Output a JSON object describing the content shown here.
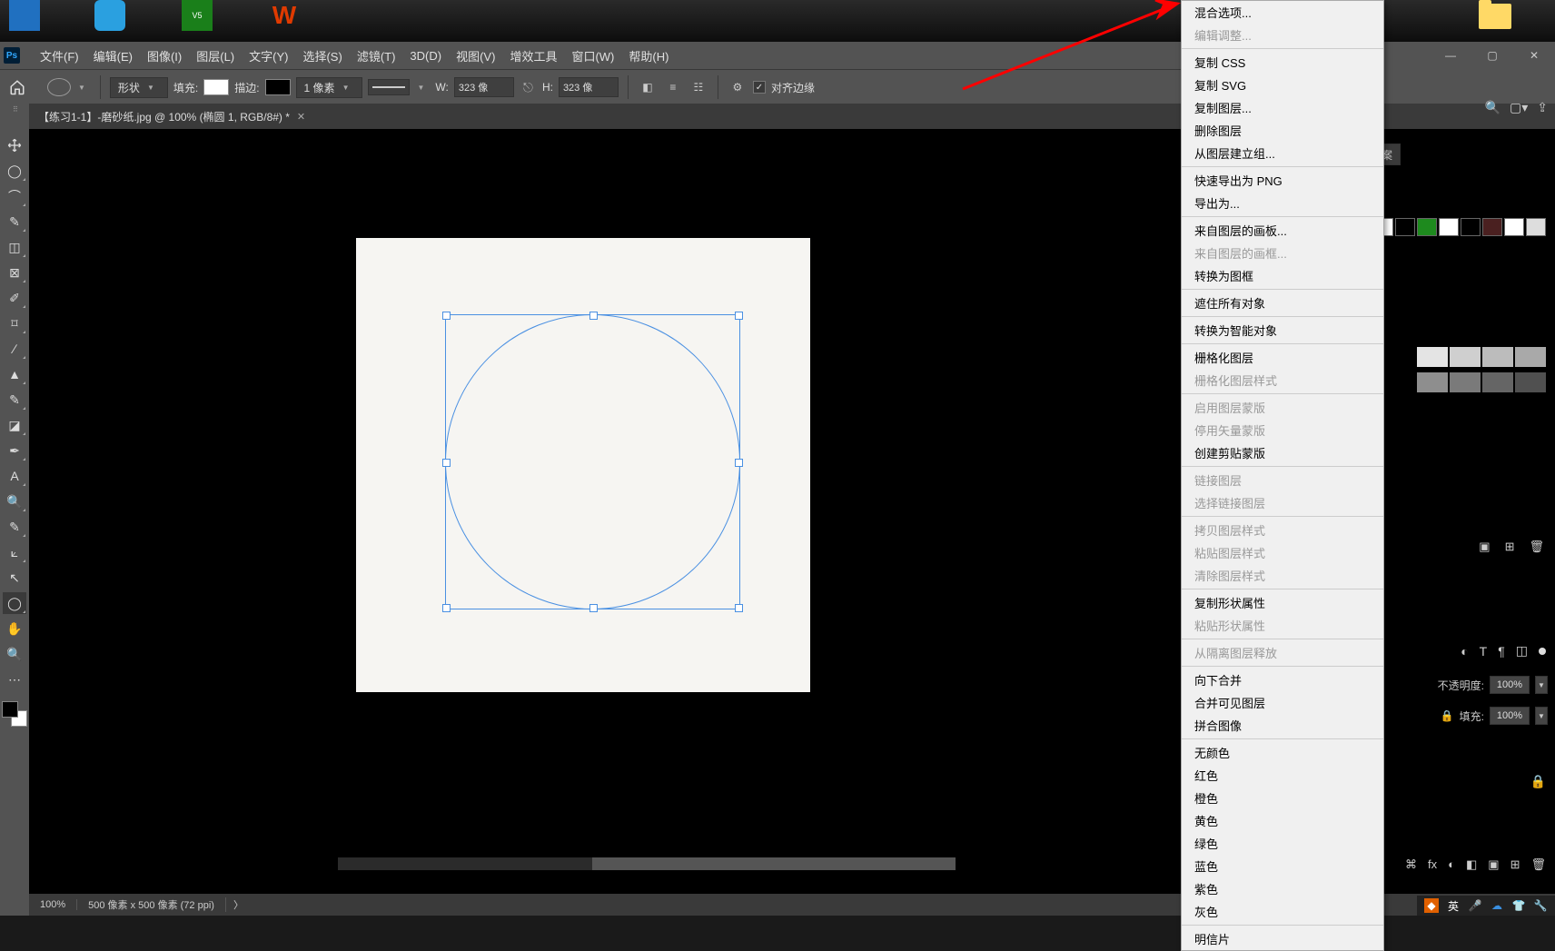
{
  "desktop": {
    "icons": [
      "app-1",
      "app-2",
      "app-3",
      "app-4"
    ]
  },
  "menu": {
    "items": [
      "文件(F)",
      "编辑(E)",
      "图像(I)",
      "图层(L)",
      "文字(Y)",
      "选择(S)",
      "滤镜(T)",
      "3D(D)",
      "视图(V)",
      "增效工具",
      "窗口(W)",
      "帮助(H)"
    ]
  },
  "options": {
    "mode_label": "形状",
    "fill_label": "填充:",
    "stroke_label": "描边:",
    "stroke_weight": "1 像素",
    "w_label": "W:",
    "w_value": "323 像",
    "h_label": "H:",
    "h_value": "323 像",
    "align_edges": "对齐边缘"
  },
  "doc_tab": {
    "title": "【练习1-1】-磨砂纸.jpg @ 100% (椭圆 1, RGB/8#) *"
  },
  "status": {
    "zoom": "100%",
    "dims": "500 像素 x 500 像素 (72 ppi)"
  },
  "right_panel": {
    "tab_label": "案",
    "opacity_label": "不透明度:",
    "opacity_value": "100%",
    "fill_label": "填充:",
    "fill_value": "100%"
  },
  "swatch_colors": [
    "#ffffff",
    "#000000",
    "#1e8a1e",
    "#ffffff",
    "#000000",
    "#4a2020",
    "#ffffff",
    "#dddddd"
  ],
  "gray_row1": [
    "#e4e4e4",
    "#cfcfcf",
    "#bcbcbc",
    "#a9a9a9"
  ],
  "gray_row2": [
    "#8e8e8e",
    "#7a7a7a",
    "#656565",
    "#505050"
  ],
  "context_menu": {
    "groups": [
      [
        {
          "label": "混合选项...",
          "enabled": true,
          "partial": true
        },
        {
          "label": "编辑调整...",
          "enabled": false
        }
      ],
      [
        {
          "label": "复制 CSS",
          "enabled": true
        },
        {
          "label": "复制 SVG",
          "enabled": true
        },
        {
          "label": "复制图层...",
          "enabled": true
        },
        {
          "label": "删除图层",
          "enabled": true
        },
        {
          "label": "从图层建立组...",
          "enabled": true
        }
      ],
      [
        {
          "label": "快速导出为 PNG",
          "enabled": true
        },
        {
          "label": "导出为...",
          "enabled": true
        }
      ],
      [
        {
          "label": "来自图层的画板...",
          "enabled": true
        },
        {
          "label": "来自图层的画框...",
          "enabled": false
        },
        {
          "label": "转换为图框",
          "enabled": true
        }
      ],
      [
        {
          "label": "遮住所有对象",
          "enabled": true
        }
      ],
      [
        {
          "label": "转换为智能对象",
          "enabled": true
        }
      ],
      [
        {
          "label": "栅格化图层",
          "enabled": true
        },
        {
          "label": "栅格化图层样式",
          "enabled": false
        }
      ],
      [
        {
          "label": "启用图层蒙版",
          "enabled": false
        },
        {
          "label": "停用矢量蒙版",
          "enabled": false
        },
        {
          "label": "创建剪贴蒙版",
          "enabled": true
        }
      ],
      [
        {
          "label": "链接图层",
          "enabled": false
        },
        {
          "label": "选择链接图层",
          "enabled": false
        }
      ],
      [
        {
          "label": "拷贝图层样式",
          "enabled": false
        },
        {
          "label": "粘贴图层样式",
          "enabled": false
        },
        {
          "label": "清除图层样式",
          "enabled": false
        }
      ],
      [
        {
          "label": "复制形状属性",
          "enabled": true
        },
        {
          "label": "粘贴形状属性",
          "enabled": false
        }
      ],
      [
        {
          "label": "从隔离图层释放",
          "enabled": false
        }
      ],
      [
        {
          "label": "向下合并",
          "enabled": true
        },
        {
          "label": "合并可见图层",
          "enabled": true
        },
        {
          "label": "拼合图像",
          "enabled": true
        }
      ],
      [
        {
          "label": "无颜色",
          "enabled": true
        },
        {
          "label": "红色",
          "enabled": true
        },
        {
          "label": "橙色",
          "enabled": true
        },
        {
          "label": "黄色",
          "enabled": true
        },
        {
          "label": "绿色",
          "enabled": true
        },
        {
          "label": "蓝色",
          "enabled": true
        },
        {
          "label": "紫色",
          "enabled": true
        },
        {
          "label": "灰色",
          "enabled": true
        }
      ],
      [
        {
          "label": "明信片",
          "enabled": true
        }
      ]
    ]
  },
  "taskbar_ime": "英"
}
